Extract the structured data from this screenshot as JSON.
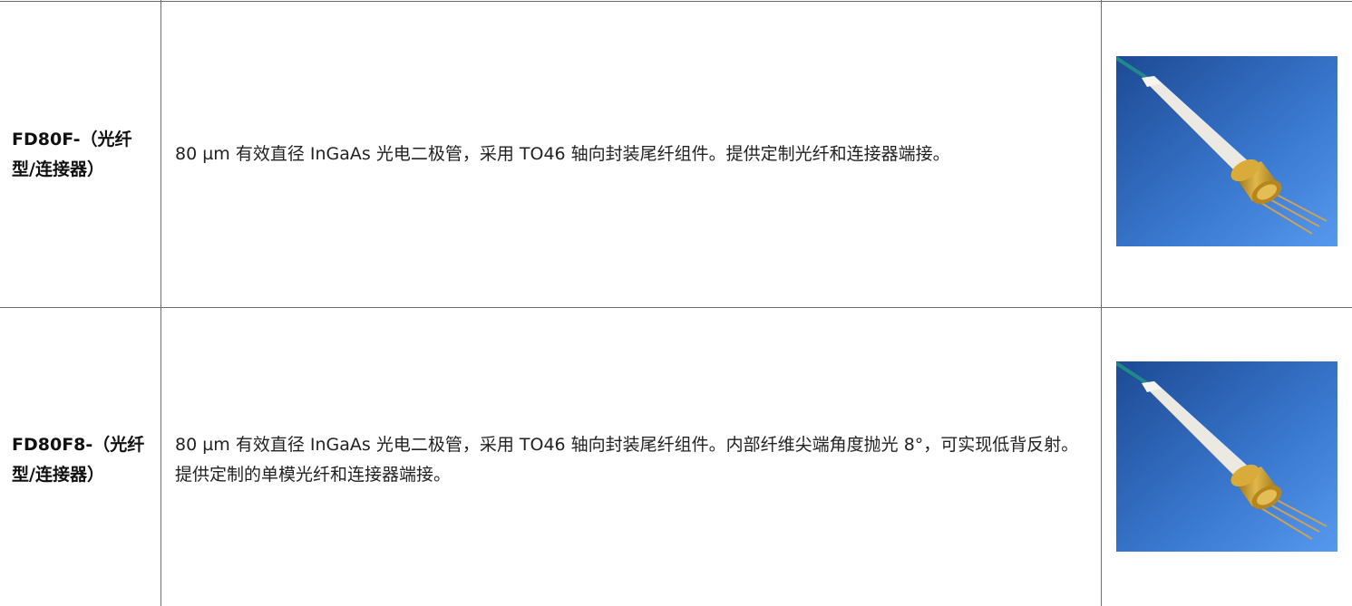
{
  "table": {
    "rows": [
      {
        "model": "FD80F-（光纤型/连接器）",
        "description": "80 µm 有效直径 InGaAs 光电二极管，采用 TO46 轴向封装尾纤组件。提供定制光纤和连接器端接。",
        "image_icon": "fiber-pigtailed-photodiode-image"
      },
      {
        "model": "FD80F8-（光纤型/连接器）",
        "description": "80 µm 有效直径 InGaAs 光电二极管，采用 TO46 轴向封装尾纤组件。内部纤维尖端角度抛光 8°，可实现低背反射。提供定制的单模光纤和连接器端接。",
        "image_icon": "fiber-pigtailed-photodiode-image"
      }
    ]
  },
  "colors": {
    "border": "#6b6b6b",
    "image_bg_top": "#1f4e9a",
    "image_bg_bottom": "#4a8fe6",
    "gold": "#c9961e"
  }
}
